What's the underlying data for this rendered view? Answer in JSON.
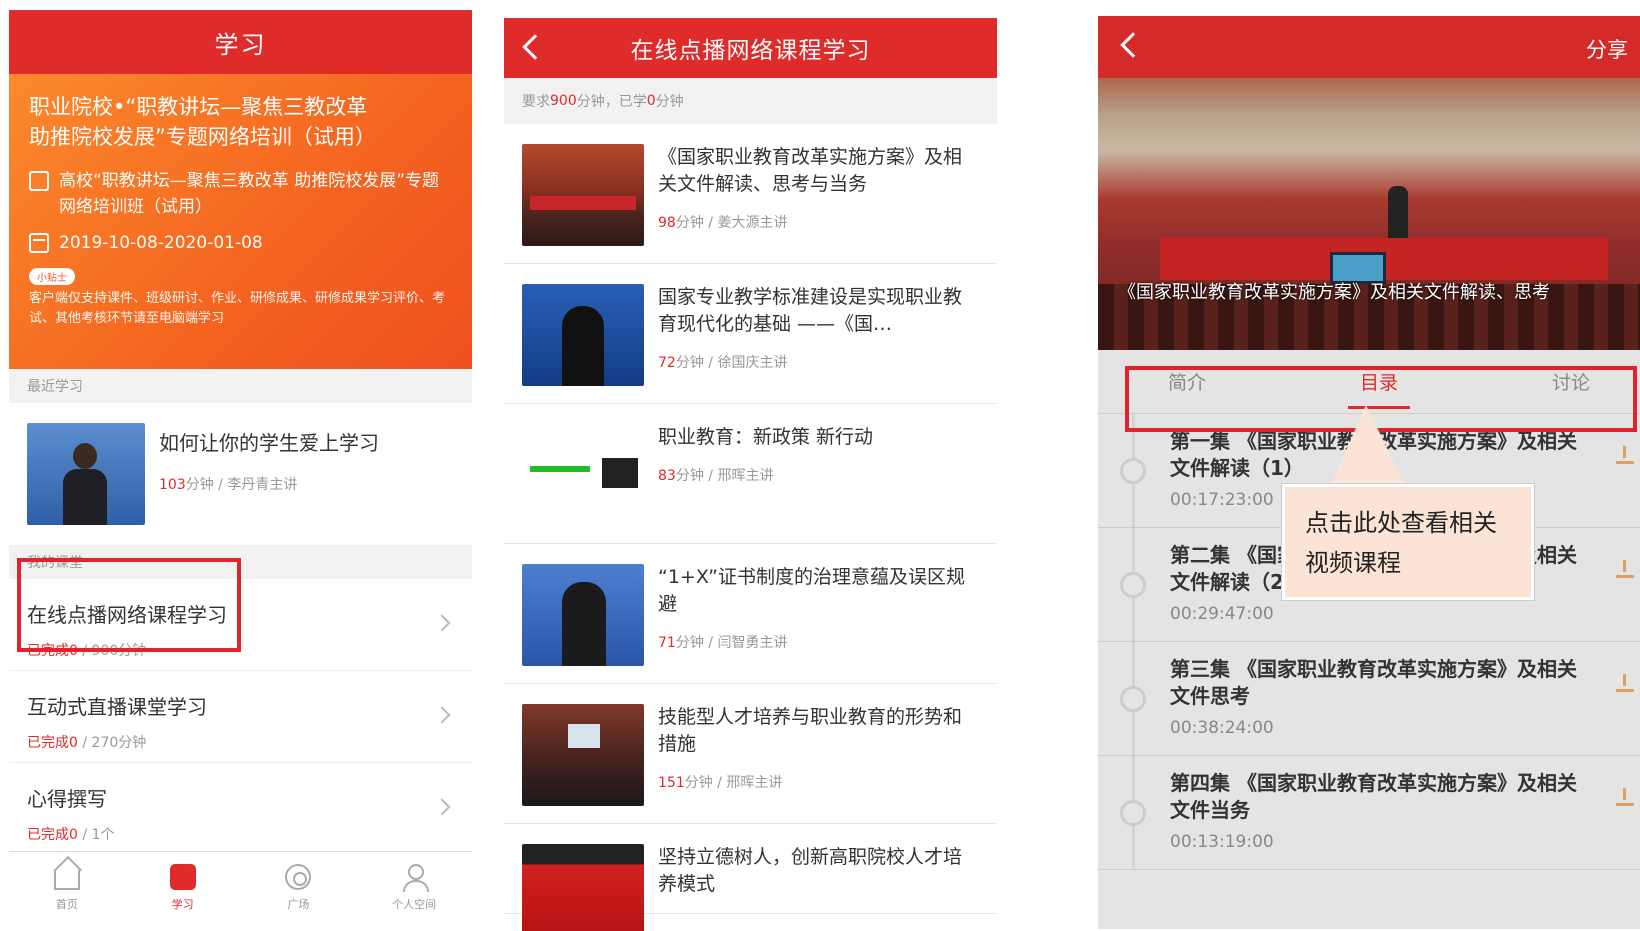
{
  "study_page": {
    "header_title": "学习",
    "program_title": "职业院校•“职教讲坛—聚焦三教改革 助推院校发展”专题网络培训（试用）",
    "class_name": "高校“职教讲坛—聚焦三教改革 助推院校发展”专题网络培训班（试用）",
    "date_range": "2019-10-08-2020-01-08",
    "tip_badge": "小贴士",
    "tip_text": "客户端仅支持课件、班级研讨、作业、研修成果、研修成果学习评价、考试、其他考核环节请至电脑端学习",
    "recent_label": "最近学习",
    "recent": {
      "title": "如何让你的学生爱上学习",
      "minutes": "103",
      "unit": "分钟 / 李丹青主讲"
    },
    "my_class_label": "我的课堂",
    "courses": [
      {
        "title": "在线点播网络课程学习",
        "done": "已完成0",
        "total": " / 900分钟"
      },
      {
        "title": "互动式直播课堂学习",
        "done": "已完成0",
        "total": " / 270分钟"
      },
      {
        "title": "心得撰写",
        "done": "已完成0",
        "total": " / 1个"
      }
    ],
    "tabbar": [
      "首页",
      "学习",
      "广场",
      "个人空间"
    ]
  },
  "course_page": {
    "header_title": "在线点播网络课程学习",
    "req_prefix": "要求",
    "req_minutes": "900",
    "req_mid": "分钟，已学",
    "req_learned": "0",
    "req_suffix": "分钟",
    "lessons": [
      {
        "title": "《国家职业教育改革实施方案》及相关文件解读、思考与当务",
        "minutes": "98",
        "speaker": "分钟 / 姜大源主讲"
      },
      {
        "title": "国家专业教学标准建设是实现职业教育现代化的基础 ——《国…",
        "minutes": "72",
        "speaker": "分钟 / 徐国庆主讲"
      },
      {
        "title": "职业教育：新政策 新行动",
        "minutes": "83",
        "speaker": "分钟 / 邢晖主讲"
      },
      {
        "title": "“1+X”证书制度的治理意蕴及误区规避",
        "minutes": "71",
        "speaker": "分钟 / 闫智勇主讲"
      },
      {
        "title": "技能型人才培养与职业教育的形势和措施",
        "minutes": "151",
        "speaker": "分钟 / 邢晖主讲"
      },
      {
        "title": "坚持立德树人，创新高职院校人才培养模式",
        "minutes": "",
        "speaker": ""
      }
    ]
  },
  "video_page": {
    "share_label": "分享",
    "subtitle": "《国家职业教育改革实施方案》及相关文件解读、思考",
    "tabs": [
      "简介",
      "目录",
      "讨论"
    ],
    "episodes": [
      {
        "title": "第一集 《国家职业教育改革实施方案》及相关文件解读（1）",
        "time": "00:17:23:00"
      },
      {
        "title": "第二集 《国家职业教育改革实施方案》及相关文件解读（2）",
        "time": "00:29:47:00"
      },
      {
        "title": "第三集 《国家职业教育改革实施方案》及相关文件思考",
        "time": "00:38:24:00"
      },
      {
        "title": "第四集 《国家职业教育改革实施方案》及相关文件当务",
        "time": "00:13:19:00"
      }
    ],
    "callout": "点击此处查看相关视频课程"
  },
  "colors": {
    "brand_red": "#e02b2b",
    "banner_orange": "#f46320",
    "highlight": "#e0242b"
  }
}
